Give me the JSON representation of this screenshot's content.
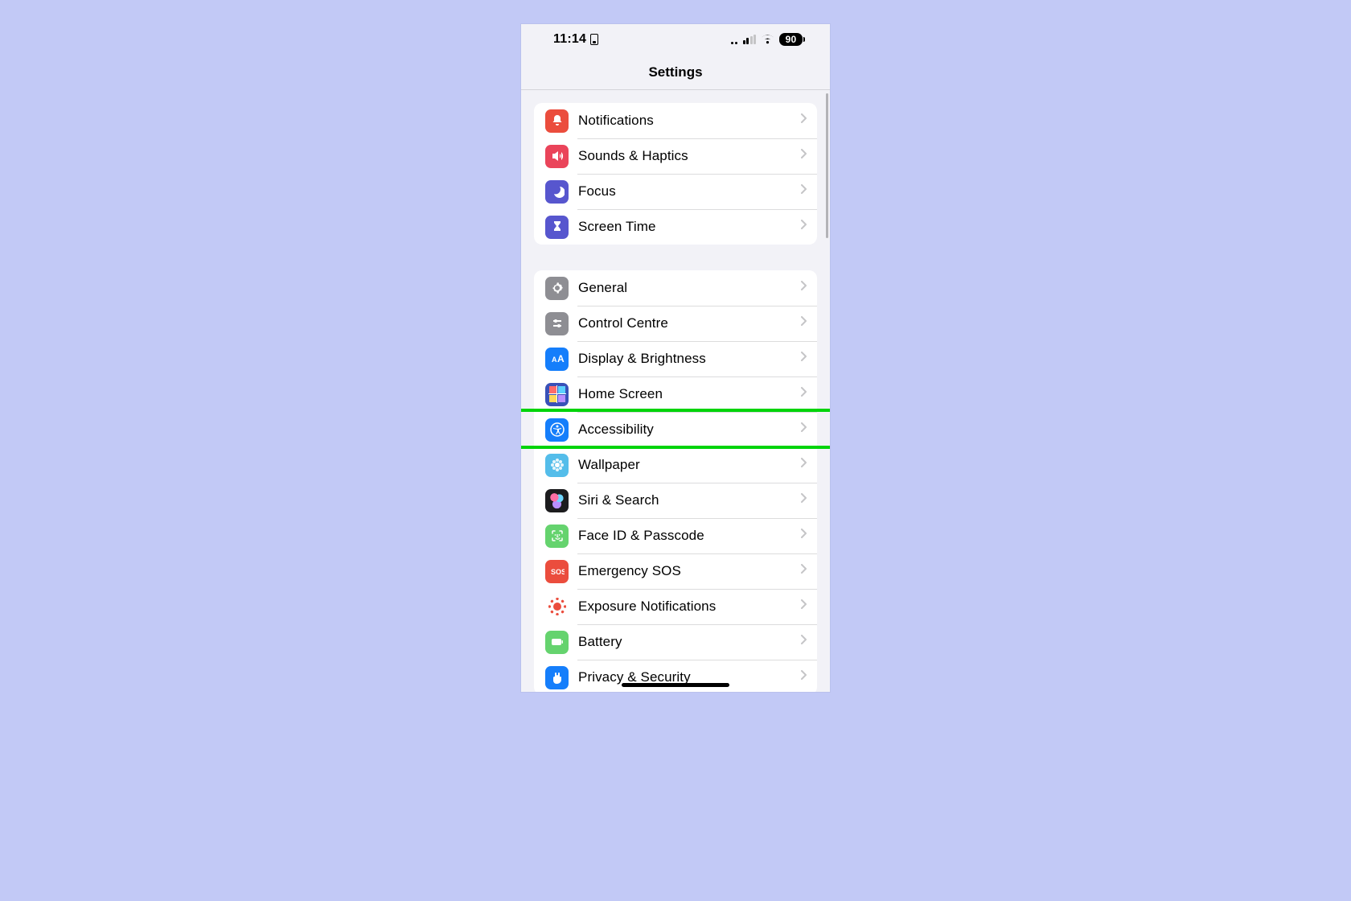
{
  "status_bar": {
    "time": "11:14",
    "battery_percent": "90"
  },
  "header": {
    "title": "Settings"
  },
  "groups": [
    {
      "id": "group-notifications",
      "rows": [
        {
          "id": "notifications",
          "label": "Notifications",
          "icon": "bell-icon",
          "icon_bg": "bg-red"
        },
        {
          "id": "sounds-haptics",
          "label": "Sounds & Haptics",
          "icon": "speaker-icon",
          "icon_bg": "bg-pink"
        },
        {
          "id": "focus",
          "label": "Focus",
          "icon": "moon-icon",
          "icon_bg": "bg-indigo"
        },
        {
          "id": "screen-time",
          "label": "Screen Time",
          "icon": "hourglass-icon",
          "icon_bg": "bg-indigo"
        }
      ]
    },
    {
      "id": "group-general",
      "rows": [
        {
          "id": "general",
          "label": "General",
          "icon": "gear-icon",
          "icon_bg": "bg-grey"
        },
        {
          "id": "control-centre",
          "label": "Control Centre",
          "icon": "sliders-icon",
          "icon_bg": "bg-grey"
        },
        {
          "id": "display-brightness",
          "label": "Display & Brightness",
          "icon": "text-size-icon",
          "icon_bg": "bg-blue"
        },
        {
          "id": "home-screen",
          "label": "Home Screen",
          "icon": "home-grid-icon",
          "icon_bg": "bg-homescreen"
        },
        {
          "id": "accessibility",
          "label": "Accessibility",
          "icon": "accessibility-icon",
          "icon_bg": "bg-blue",
          "highlighted": true
        },
        {
          "id": "wallpaper",
          "label": "Wallpaper",
          "icon": "flower-icon",
          "icon_bg": "bg-cyan"
        },
        {
          "id": "siri-search",
          "label": "Siri & Search",
          "icon": "siri-icon",
          "icon_bg": "bg-siri"
        },
        {
          "id": "face-id-passcode",
          "label": "Face ID & Passcode",
          "icon": "face-id-icon",
          "icon_bg": "bg-green"
        },
        {
          "id": "emergency-sos",
          "label": "Emergency SOS",
          "icon": "sos-icon",
          "icon_bg": "bg-sosred"
        },
        {
          "id": "exposure-notifications",
          "label": "Exposure Notifications",
          "icon": "exposure-icon",
          "icon_bg": "bg-white"
        },
        {
          "id": "battery",
          "label": "Battery",
          "icon": "battery-icon",
          "icon_bg": "bg-battery"
        },
        {
          "id": "privacy-security",
          "label": "Privacy & Security",
          "icon": "hand-icon",
          "icon_bg": "bg-privacy"
        }
      ]
    }
  ]
}
